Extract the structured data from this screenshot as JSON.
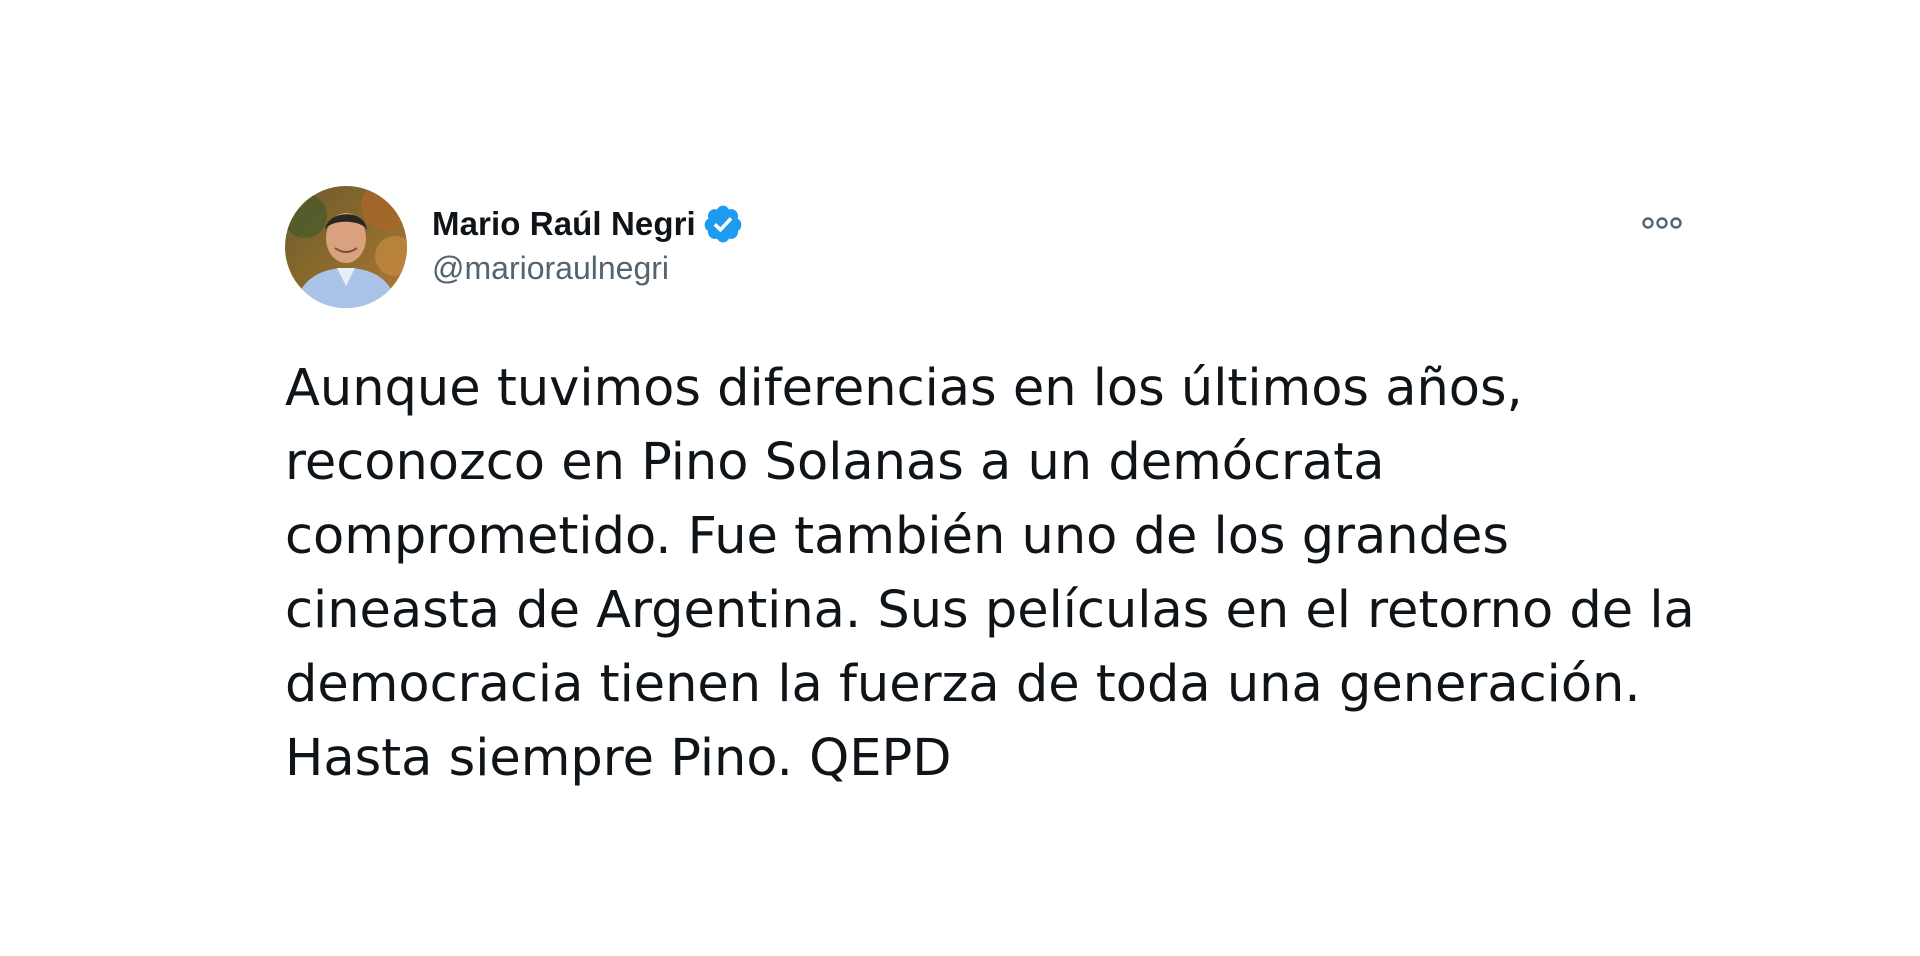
{
  "tweet": {
    "author": {
      "display_name": "Mario Raúl Negri",
      "handle": "@marioraulnegri",
      "verified": true,
      "verified_badge_color": "#1d9bf0"
    },
    "text_lines": [
      "Aunque tuvimos diferencias en los últimos años,",
      "reconozco en Pino Solanas a un demócrata",
      "comprometido. Fue también uno de los grandes",
      "cineasta de Argentina. Sus películas en el retorno de la",
      "democracia tienen la fuerza de toda una generación.",
      "Hasta siempre Pino. QEPD"
    ],
    "more_icon": "more-options-icon"
  }
}
